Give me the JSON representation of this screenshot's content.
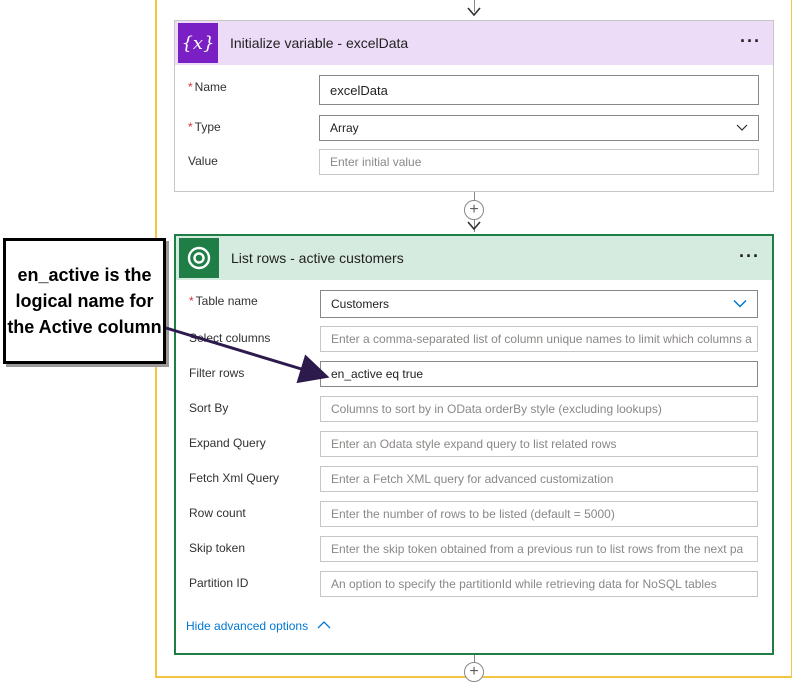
{
  "init_card": {
    "icon": "{x}",
    "title": "Initialize variable - excelData",
    "more": "···",
    "fields": [
      {
        "label": "Name",
        "required": "*",
        "value": "excelData"
      },
      {
        "label": "Type",
        "required": "*",
        "value": "Array"
      },
      {
        "label": "Value",
        "placeholder": "Enter initial value"
      }
    ]
  },
  "list_card": {
    "title": "List rows - active customers",
    "more": "···",
    "fields": [
      {
        "label": "Table name",
        "required": "*",
        "value": "Customers"
      },
      {
        "label": "Select columns",
        "placeholder": "Enter a comma-separated list of column unique names to limit which columns a"
      },
      {
        "label": "Filter rows",
        "value": "en_active eq true"
      },
      {
        "label": "Sort By",
        "placeholder": "Columns to sort by in OData orderBy style (excluding lookups)"
      },
      {
        "label": "Expand Query",
        "placeholder": "Enter an Odata style expand query to list related rows"
      },
      {
        "label": "Fetch Xml Query",
        "placeholder": "Enter a Fetch XML query for advanced customization"
      },
      {
        "label": "Row count",
        "placeholder": "Enter the number of rows to be listed (default = 5000)"
      },
      {
        "label": "Skip token",
        "placeholder": "Enter the skip token obtained from a previous run to list rows from the next pa"
      },
      {
        "label": "Partition ID",
        "placeholder": "An option to specify the partitionId while retrieving data for NoSQL tables"
      }
    ],
    "advanced_toggle": "Hide advanced options"
  },
  "callout": {
    "text": "en_active is the logical name for the Active column"
  },
  "colors": {
    "scope_border": "#f4c542",
    "variable_accent": "#7a1fc3",
    "dataverse_accent": "#1e7e45",
    "link": "#0078d4",
    "required": "#d13438"
  }
}
